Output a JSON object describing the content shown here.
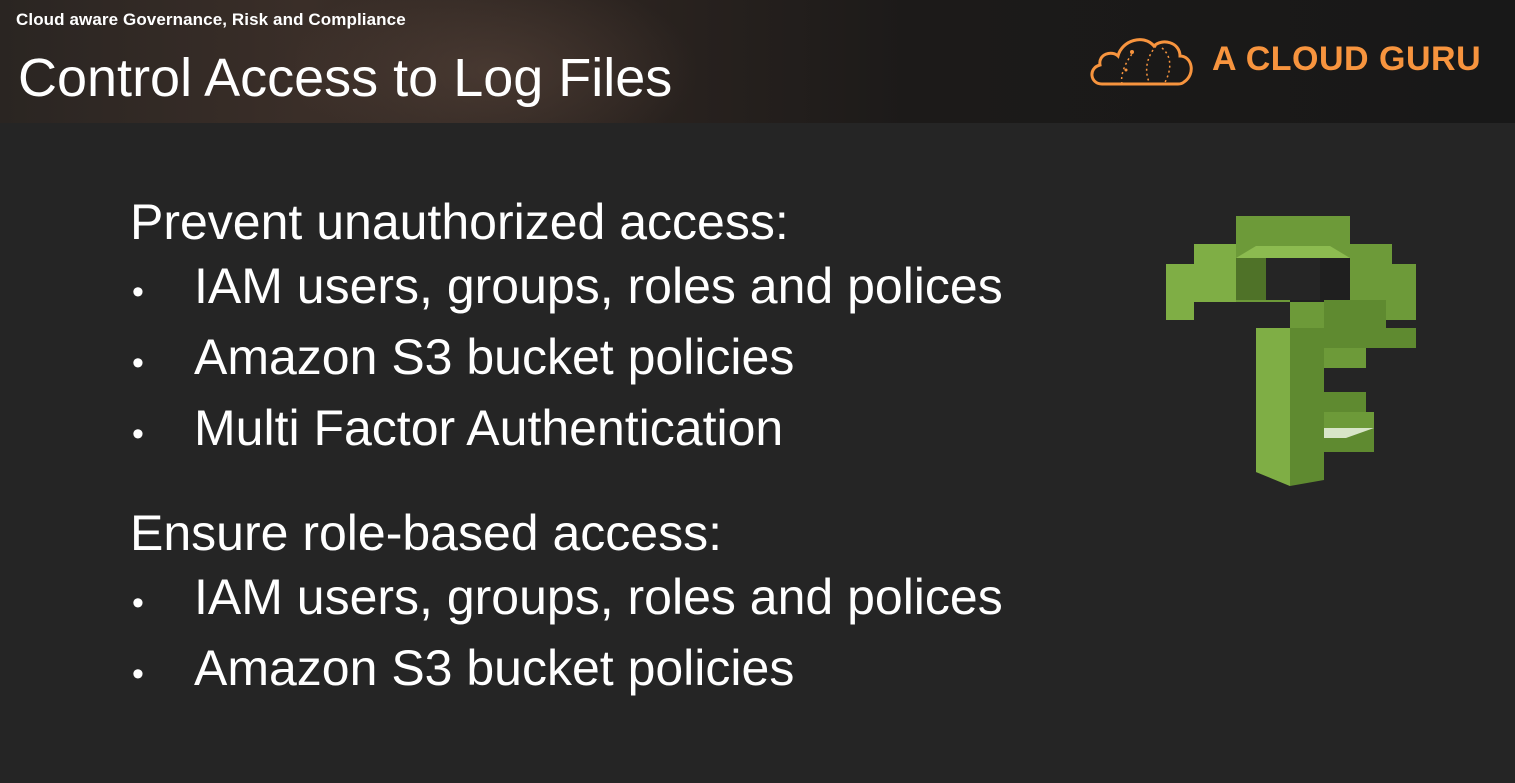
{
  "header": {
    "course_title": "Cloud aware Governance, Risk and Compliance",
    "slide_title": "Control Access to Log Files",
    "brand_name": "A CLOUD GURU",
    "brand_color": "#f7943e",
    "brand_icon": "cloud-logo-icon"
  },
  "sections": [
    {
      "heading": "Prevent unauthorized access:",
      "bullets": [
        "IAM users, groups, roles and polices",
        "Amazon S3 bucket policies",
        "Multi Factor Authentication"
      ]
    },
    {
      "heading": "Ensure role-based access:",
      "bullets": [
        "IAM users, groups, roles and polices",
        "Amazon S3 bucket policies"
      ]
    }
  ],
  "bullet_glyph": "•",
  "graphic": {
    "icon": "iam-key-icon",
    "color": "#6d9a39"
  }
}
